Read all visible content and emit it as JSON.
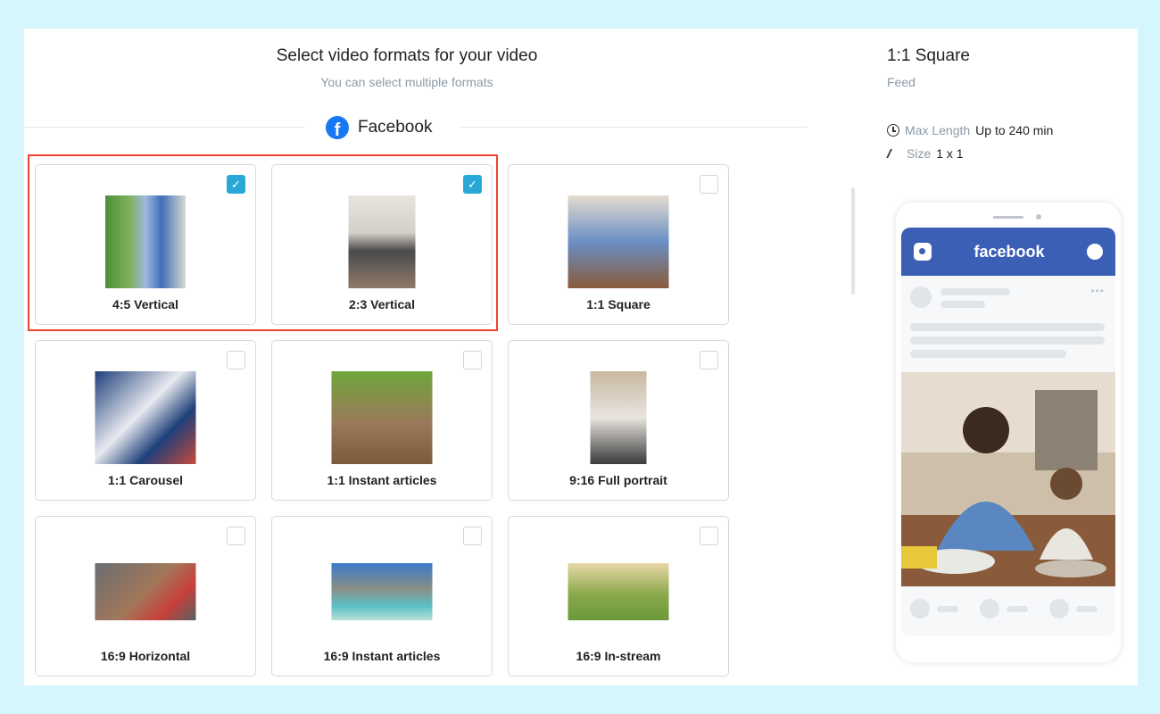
{
  "header": {
    "title": "Select video formats for your video",
    "subtitle": "You can select multiple formats"
  },
  "platform": {
    "name": "Facebook",
    "icon": "facebook-icon"
  },
  "formats": [
    {
      "label": "4:5 Vertical",
      "checked": true,
      "thumb": "woman-floral-dress"
    },
    {
      "label": "2:3 Vertical",
      "checked": true,
      "thumb": "woman-cooking"
    },
    {
      "label": "1:1 Square",
      "checked": false,
      "thumb": "father-daughter-eating"
    },
    {
      "label": "1:1 Carousel",
      "checked": false,
      "thumb": "baseball-player"
    },
    {
      "label": "1:1 Instant articles",
      "checked": false,
      "thumb": "kittens-playing"
    },
    {
      "label": "9:16 Full portrait",
      "checked": false,
      "thumb": "man-on-bicycle"
    },
    {
      "label": "16:9 Horizontal",
      "checked": false,
      "thumb": "vegetables-cutting-board"
    },
    {
      "label": "16:9 Instant articles",
      "checked": false,
      "thumb": "tropical-boat"
    },
    {
      "label": "16:9 In-stream",
      "checked": false,
      "thumb": "family-walking"
    }
  ],
  "details": {
    "title": "1:1 Square",
    "placement": "Feed",
    "max_length_label": "Max Length",
    "max_length_value": "Up to 240 min",
    "size_label": "Size",
    "size_value": "1 x 1"
  },
  "preview": {
    "brand": "facebook"
  },
  "colors": {
    "accent": "#29a8d8",
    "highlight": "#f0442c",
    "facebook_blue": "#3b5fb5"
  }
}
